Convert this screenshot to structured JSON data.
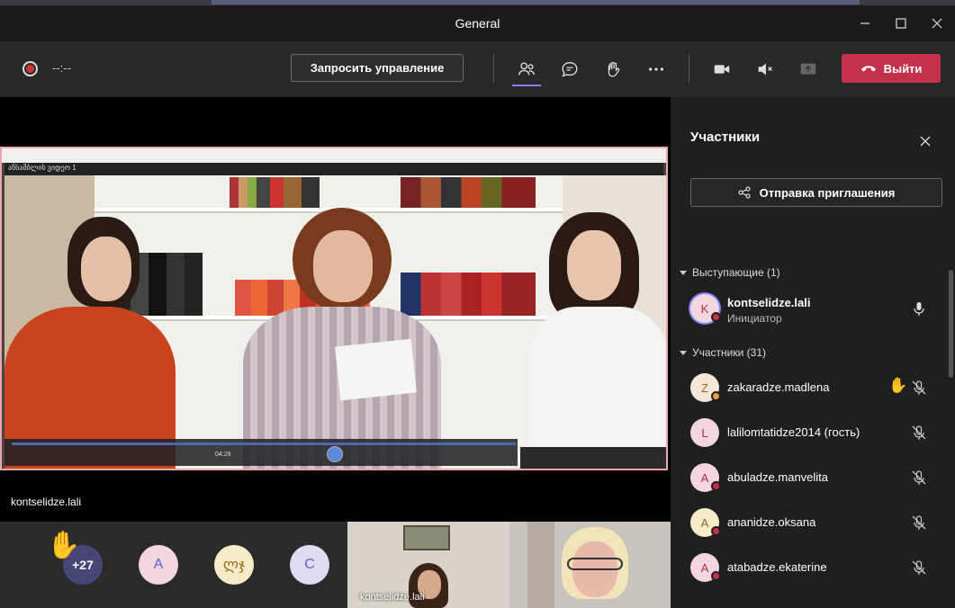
{
  "window": {
    "title": "General"
  },
  "toolbar": {
    "timer": "--:--",
    "request_control_label": "Запросить управление",
    "leave_label": "Выйти",
    "icons": [
      "participants-icon",
      "chat-icon",
      "raise-hand-icon",
      "more-icon",
      "camera-icon",
      "mute-icon",
      "share-icon"
    ]
  },
  "stage": {
    "speaker_label": "kontselidze.lali",
    "video_window_title": "ანსამბლის ვიდეო 1",
    "player_time": "04:29"
  },
  "bottom": {
    "overflow_count": "+27",
    "avatars": [
      {
        "initials": "A",
        "color": "#f3d6e0"
      },
      {
        "initials": "ლჯ",
        "color": "#f8ecc8"
      },
      {
        "initials": "C",
        "color": "#e0dcf3"
      }
    ],
    "thumb_label": "kontselidze.lali"
  },
  "panel": {
    "title": "Участники",
    "invite_label": "Отправка приглашения",
    "presenters_header": "Выступающие (1)",
    "participants_header": "Участники (31)",
    "presenters": [
      {
        "initial": "K",
        "name": "kontselidze.lali",
        "role": "Инициатор",
        "avatar_color": "#f3d6e0",
        "text_color": "#a33"
      }
    ],
    "participants": [
      {
        "initial": "Z",
        "name": "zakaradze.madlena",
        "avatar_color": "#f6e6d6",
        "text_color": "#a05a2c",
        "status": "#e9a23b",
        "hand": true
      },
      {
        "initial": "L",
        "name": "lalilomtatidze2014 (гость)",
        "avatar_color": "#f3d6e0",
        "text_color": "#a33",
        "status": "",
        "hand": false
      },
      {
        "initial": "A",
        "name": "abuladze.manvelita",
        "avatar_color": "#f3d6e0",
        "text_color": "#a33",
        "status": "#c4314b",
        "hand": false
      },
      {
        "initial": "A",
        "name": "ananidze.oksana",
        "avatar_color": "#f8ecc8",
        "text_color": "#8a6d1d",
        "status": "#c4314b",
        "hand": false
      },
      {
        "initial": "A",
        "name": "atabadze.ekaterine",
        "avatar_color": "#f3d6e0",
        "text_color": "#a33",
        "status": "#c4314b",
        "hand": false
      }
    ]
  }
}
